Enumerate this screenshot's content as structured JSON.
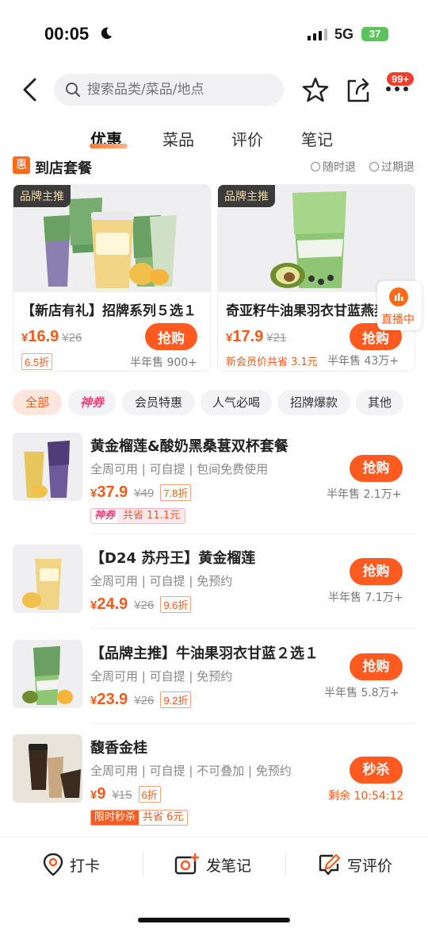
{
  "status_bar": {
    "time": "00:05",
    "network": "5G",
    "battery": "37"
  },
  "nav": {
    "search_placeholder": "搜索品类/菜品/地点",
    "badge": "99+"
  },
  "tabs": [
    {
      "label": "优惠",
      "active": true
    },
    {
      "label": "菜品",
      "active": false
    },
    {
      "label": "评价",
      "active": false
    },
    {
      "label": "笔记",
      "active": false
    }
  ],
  "section": {
    "icon_text": "惠",
    "title": "到店套餐",
    "policy1": "随时退",
    "policy2": "过期退"
  },
  "cards": [
    {
      "tag": "品牌主推",
      "name": "【新店有礼】招牌系列５选１",
      "currency": "¥",
      "price": "16.9",
      "orig": "¥26",
      "discount": "6.5折",
      "extra": "",
      "buy": "抢购",
      "sold": "半年售 900+"
    },
    {
      "tag": "品牌主推",
      "name": "奇亚籽牛油果羽衣甘蓝燕麦",
      "currency": "¥",
      "price": "17.9",
      "orig": "¥21",
      "discount": "",
      "extra": "新会员价共省 3.1元",
      "buy": "抢购",
      "sold": "半年售 43万+"
    }
  ],
  "live": {
    "label": "直播中"
  },
  "filters": [
    "全部",
    "神券",
    "会员特惠",
    "人气必喝",
    "招牌爆款",
    "其他"
  ],
  "items": [
    {
      "title": "黄金榴莲&酸奶黑桑葚双杯套餐",
      "tags": "全周可用 | 可自提 | 包间免费使用",
      "currency": "¥",
      "price": "37.9",
      "orig": "¥49",
      "discount": "7.8折",
      "button": "抢购",
      "sold": "半年售 2.1万+",
      "badge_a": "神券",
      "badge_b": "共省 11.1元"
    },
    {
      "title": "【D24 苏丹王】黄金榴莲",
      "tags": "全周可用 | 可自提 | 免预约",
      "currency": "¥",
      "price": "24.9",
      "orig": "¥26",
      "discount": "9.6折",
      "button": "抢购",
      "sold": "半年售 7.1万+"
    },
    {
      "title": "【品牌主推】牛油果羽衣甘蓝２选１",
      "tags": "全周可用 | 可自提 | 免预约",
      "currency": "¥",
      "price": "23.9",
      "orig": "¥26",
      "discount": "9.2折",
      "button": "抢购",
      "sold": "半年售 5.8万+"
    },
    {
      "title": "馥香金桂",
      "tags": "全周可用 | 可自提 | 不可叠加 | 免预约",
      "currency": "¥",
      "price": "9",
      "orig": "¥15",
      "discount": "6折",
      "button": "秒杀",
      "sold": "剩余 10:54:12",
      "badge_a": "限时秒杀",
      "badge_b": "共省 6元"
    }
  ],
  "bottom_bar": [
    {
      "label": "打卡",
      "icon": "location-pin-icon"
    },
    {
      "label": "发笔记",
      "icon": "camera-plus-icon"
    },
    {
      "label": "写评价",
      "icon": "edit-review-icon"
    }
  ],
  "colors": {
    "accent": "#ff5a1f",
    "price": "#f05a1a",
    "shen": "#f0417a",
    "brand_tag_bg": "#3b3b3b"
  }
}
